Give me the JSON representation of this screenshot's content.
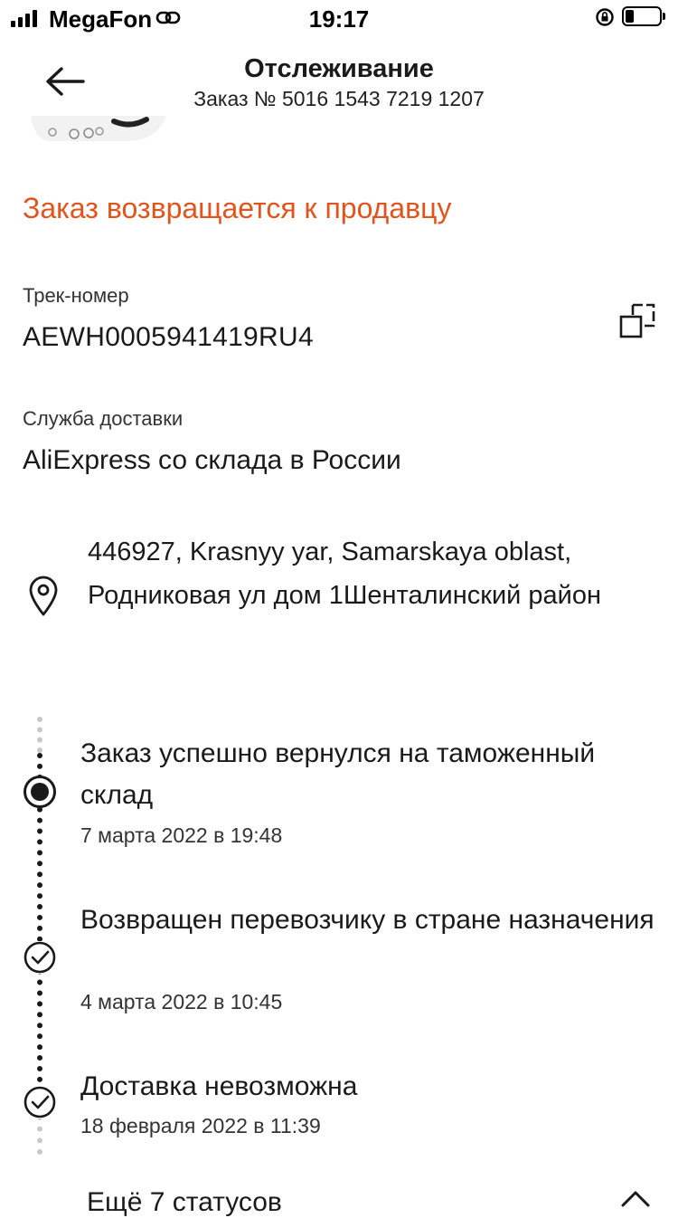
{
  "status_bar": {
    "carrier": "MegaFon",
    "time": "19:17",
    "battery_level": 0.2
  },
  "header": {
    "title": "Отслеживание",
    "order_number": "Заказ № 5016 1543 7219 1207",
    "back_icon": "arrow-left-icon"
  },
  "order_status": "Заказ возвращается к продавцу",
  "tracking": {
    "label": "Трек-номер",
    "number": "AEWH0005941419RU4",
    "copy_icon": "copy-icon"
  },
  "delivery_service": {
    "label": "Служба доставки",
    "value": "AliExpress со склада в России"
  },
  "address": "446927, Krasnyy yar, Samarskaya oblast, Родниковая ул дом 1Шенталинский район",
  "events": [
    {
      "title": "Заказ успешно вернулся на таможенный склад",
      "date": "7 марта 2022 в 19:48",
      "state": "current"
    },
    {
      "title": "Возвращен перевозчику в стране назначения",
      "date": "4 марта 2022 в 10:45",
      "state": "done"
    },
    {
      "title": "Доставка невозможна",
      "date": "18 февраля 2022 в 11:39",
      "state": "done"
    }
  ],
  "more_statuses": "Ещё 7 статусов",
  "colors": {
    "accent": "#e3541c",
    "text": "#1a1a1a"
  }
}
